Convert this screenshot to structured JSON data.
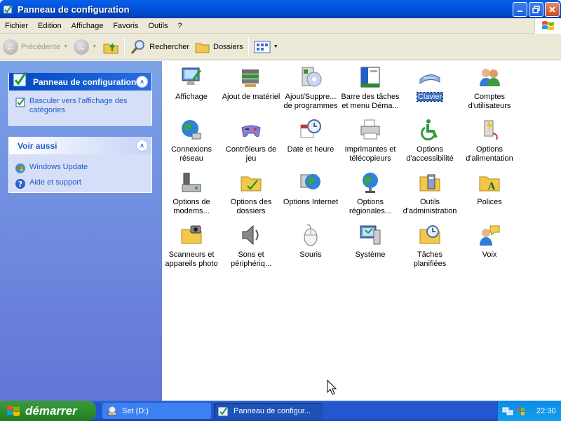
{
  "window": {
    "title": "Panneau de configuration"
  },
  "menu": {
    "items": [
      "Fichier",
      "Edition",
      "Affichage",
      "Favoris",
      "Outils",
      "?"
    ]
  },
  "toolbar": {
    "back_label": "Précédente",
    "search_label": "Rechercher",
    "folders_label": "Dossiers"
  },
  "sidebar": {
    "panel_title": "Panneau de configuration",
    "switch_link": "Basculer vers l'affichage des catégories",
    "see_also_title": "Voir aussi",
    "links": [
      "Windows Update",
      "Aide et support"
    ]
  },
  "items": [
    {
      "label": "Affichage",
      "icon": "display-icon"
    },
    {
      "label": "Ajout de matériel",
      "icon": "add-hardware-icon"
    },
    {
      "label": "Ajout/Suppre... de programmes",
      "icon": "add-remove-programs-icon"
    },
    {
      "label": "Barre des tâches et menu Déma...",
      "icon": "taskbar-icon"
    },
    {
      "label": "Clavier",
      "icon": "keyboard-icon",
      "selected": true
    },
    {
      "label": "Comptes d'utilisateurs",
      "icon": "user-accounts-icon"
    },
    {
      "label": "Connexions réseau",
      "icon": "network-icon"
    },
    {
      "label": "Contrôleurs de jeu",
      "icon": "game-controller-icon"
    },
    {
      "label": "Date et heure",
      "icon": "clock-icon"
    },
    {
      "label": "Imprimantes et télécopieurs",
      "icon": "printer-icon"
    },
    {
      "label": "Options d'accessibilité",
      "icon": "accessibility-icon"
    },
    {
      "label": "Options d'alimentation",
      "icon": "power-icon"
    },
    {
      "label": "Options de modems...",
      "icon": "modem-icon"
    },
    {
      "label": "Options des dossiers",
      "icon": "folder-options-icon"
    },
    {
      "label": "Options Internet",
      "icon": "internet-icon"
    },
    {
      "label": "Options régionales...",
      "icon": "globe-icon"
    },
    {
      "label": "Outils d'administration",
      "icon": "admin-tools-icon"
    },
    {
      "label": "Polices",
      "icon": "fonts-folder-icon"
    },
    {
      "label": "Scanneurs et appareils photo",
      "icon": "scanner-icon"
    },
    {
      "label": "Sons et périphériq...",
      "icon": "speaker-icon"
    },
    {
      "label": "Souris",
      "icon": "mouse-icon"
    },
    {
      "label": "Système",
      "icon": "system-icon"
    },
    {
      "label": "Tâches planifiées",
      "icon": "scheduled-tasks-icon"
    },
    {
      "label": "Voix",
      "icon": "speech-icon"
    }
  ],
  "taskbar": {
    "start_label": "démarrer",
    "tasks": [
      "Set (D:)",
      "Panneau de configur..."
    ],
    "clock": "22:30"
  }
}
